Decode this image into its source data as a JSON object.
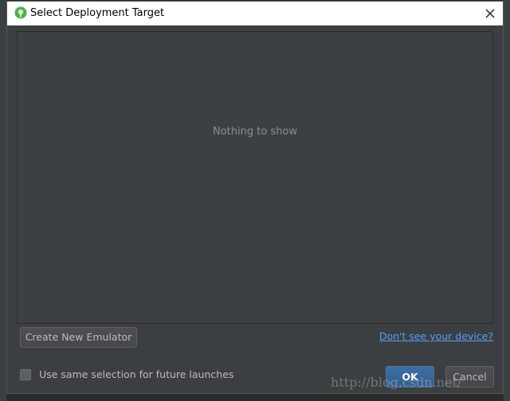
{
  "window": {
    "title": "Select Deployment Target",
    "icon": "android-studio-icon",
    "close_symbol": "✕"
  },
  "device_list": {
    "empty_text": "Nothing to show"
  },
  "actions": {
    "create_emulator_label": "Create New Emulator",
    "help_link_label": "Don't see your device?",
    "remember_selection_label": "Use same selection for future launches",
    "ok_label": "OK",
    "cancel_label": "Cancel"
  },
  "colors": {
    "dialog_bg": "#3c3f41",
    "list_bg": "#3d4043",
    "link": "#589df6",
    "primary_button": "#365d8d"
  },
  "watermark": "http://blog.csdn.net/"
}
